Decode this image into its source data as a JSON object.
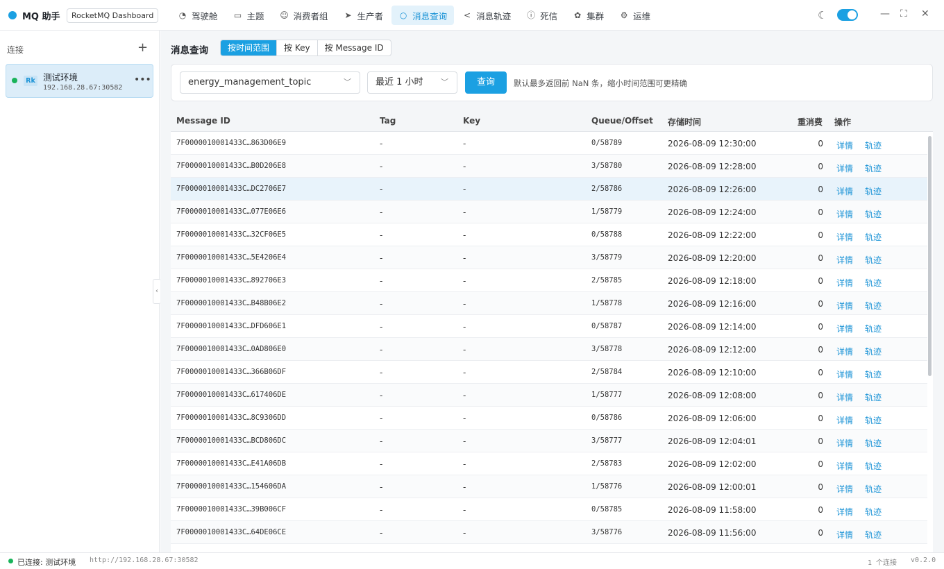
{
  "app": {
    "name": "MQ 助手",
    "tag": "RocketMQ Dashboard"
  },
  "nav": [
    {
      "label": "驾驶舱",
      "icon": "dashboard-icon",
      "glyph": "◔"
    },
    {
      "label": "主题",
      "icon": "folder-icon",
      "glyph": "▭"
    },
    {
      "label": "消费者组",
      "icon": "user-icon",
      "glyph": "☺"
    },
    {
      "label": "生产者",
      "icon": "send-icon",
      "glyph": "➤"
    },
    {
      "label": "消息查询",
      "icon": "search-icon",
      "glyph": "○",
      "active": true
    },
    {
      "label": "消息轨迹",
      "icon": "share-icon",
      "glyph": "<"
    },
    {
      "label": "死信",
      "icon": "alert-circle-icon",
      "glyph": "ⓘ"
    },
    {
      "label": "集群",
      "icon": "cluster-icon",
      "glyph": "✿"
    },
    {
      "label": "运维",
      "icon": "gear-icon",
      "glyph": "⚙"
    }
  ],
  "sidebar": {
    "title": "连接",
    "connection": {
      "badge": "Rk",
      "name": "测试环境",
      "address": "192.168.28.67:30582",
      "status_color": "#19b35a"
    }
  },
  "page": {
    "title": "消息查询",
    "modes": [
      "按时间范围",
      "按 Key",
      "按 Message ID"
    ],
    "active_mode": 0
  },
  "query": {
    "topic": "energy_management_topic",
    "time_range": "最近 1 小时",
    "button": "查询",
    "hint": "默认最多返回前 NaN 条，缩小时间范围可更精确"
  },
  "table": {
    "columns": [
      "Message ID",
      "Tag",
      "Key",
      "Queue/Offset",
      "存储时间",
      "重消费",
      "操作"
    ],
    "actions": [
      "详情",
      "轨迹"
    ],
    "rows": [
      {
        "id": "7F0000010001433C…863D06E9",
        "tag": "-",
        "key": "-",
        "qo": "0/58789",
        "time": "2026-08-09 12:30:00",
        "retry": "0"
      },
      {
        "id": "7F0000010001433C…B0D206E8",
        "tag": "-",
        "key": "-",
        "qo": "3/58780",
        "time": "2026-08-09 12:28:00",
        "retry": "0"
      },
      {
        "id": "7F0000010001433C…DC2706E7",
        "tag": "-",
        "key": "-",
        "qo": "2/58786",
        "time": "2026-08-09 12:26:00",
        "retry": "0"
      },
      {
        "id": "7F0000010001433C…077E06E6",
        "tag": "-",
        "key": "-",
        "qo": "1/58779",
        "time": "2026-08-09 12:24:00",
        "retry": "0"
      },
      {
        "id": "7F0000010001433C…32CF06E5",
        "tag": "-",
        "key": "-",
        "qo": "0/58788",
        "time": "2026-08-09 12:22:00",
        "retry": "0"
      },
      {
        "id": "7F0000010001433C…5E4206E4",
        "tag": "-",
        "key": "-",
        "qo": "3/58779",
        "time": "2026-08-09 12:20:00",
        "retry": "0"
      },
      {
        "id": "7F0000010001433C…892706E3",
        "tag": "-",
        "key": "-",
        "qo": "2/58785",
        "time": "2026-08-09 12:18:00",
        "retry": "0"
      },
      {
        "id": "7F0000010001433C…B48B06E2",
        "tag": "-",
        "key": "-",
        "qo": "1/58778",
        "time": "2026-08-09 12:16:00",
        "retry": "0"
      },
      {
        "id": "7F0000010001433C…DFD606E1",
        "tag": "-",
        "key": "-",
        "qo": "0/58787",
        "time": "2026-08-09 12:14:00",
        "retry": "0"
      },
      {
        "id": "7F0000010001433C…0AD806E0",
        "tag": "-",
        "key": "-",
        "qo": "3/58778",
        "time": "2026-08-09 12:12:00",
        "retry": "0"
      },
      {
        "id": "7F0000010001433C…366B06DF",
        "tag": "-",
        "key": "-",
        "qo": "2/58784",
        "time": "2026-08-09 12:10:00",
        "retry": "0"
      },
      {
        "id": "7F0000010001433C…617406DE",
        "tag": "-",
        "key": "-",
        "qo": "1/58777",
        "time": "2026-08-09 12:08:00",
        "retry": "0"
      },
      {
        "id": "7F0000010001433C…8C9306DD",
        "tag": "-",
        "key": "-",
        "qo": "0/58786",
        "time": "2026-08-09 12:06:00",
        "retry": "0"
      },
      {
        "id": "7F0000010001433C…BCD806DC",
        "tag": "-",
        "key": "-",
        "qo": "3/58777",
        "time": "2026-08-09 12:04:01",
        "retry": "0"
      },
      {
        "id": "7F0000010001433C…E41A06DB",
        "tag": "-",
        "key": "-",
        "qo": "2/58783",
        "time": "2026-08-09 12:02:00",
        "retry": "0"
      },
      {
        "id": "7F0000010001433C…154606DA",
        "tag": "-",
        "key": "-",
        "qo": "1/58776",
        "time": "2026-08-09 12:00:01",
        "retry": "0"
      },
      {
        "id": "7F0000010001433C…39B006CF",
        "tag": "-",
        "key": "-",
        "qo": "0/58785",
        "time": "2026-08-09 11:58:00",
        "retry": "0"
      },
      {
        "id": "7F0000010001433C…64DE06CE",
        "tag": "-",
        "key": "-",
        "qo": "3/58776",
        "time": "2026-08-09 11:56:00",
        "retry": "0"
      }
    ],
    "selected_row": 2
  },
  "status": {
    "connected": "已连接: 测试环境",
    "url": "http://192.168.28.67:30582",
    "count": "1 个连接",
    "version": "v0.2.0"
  },
  "colors": {
    "accent": "#1ba0e2",
    "online": "#19b35a"
  }
}
